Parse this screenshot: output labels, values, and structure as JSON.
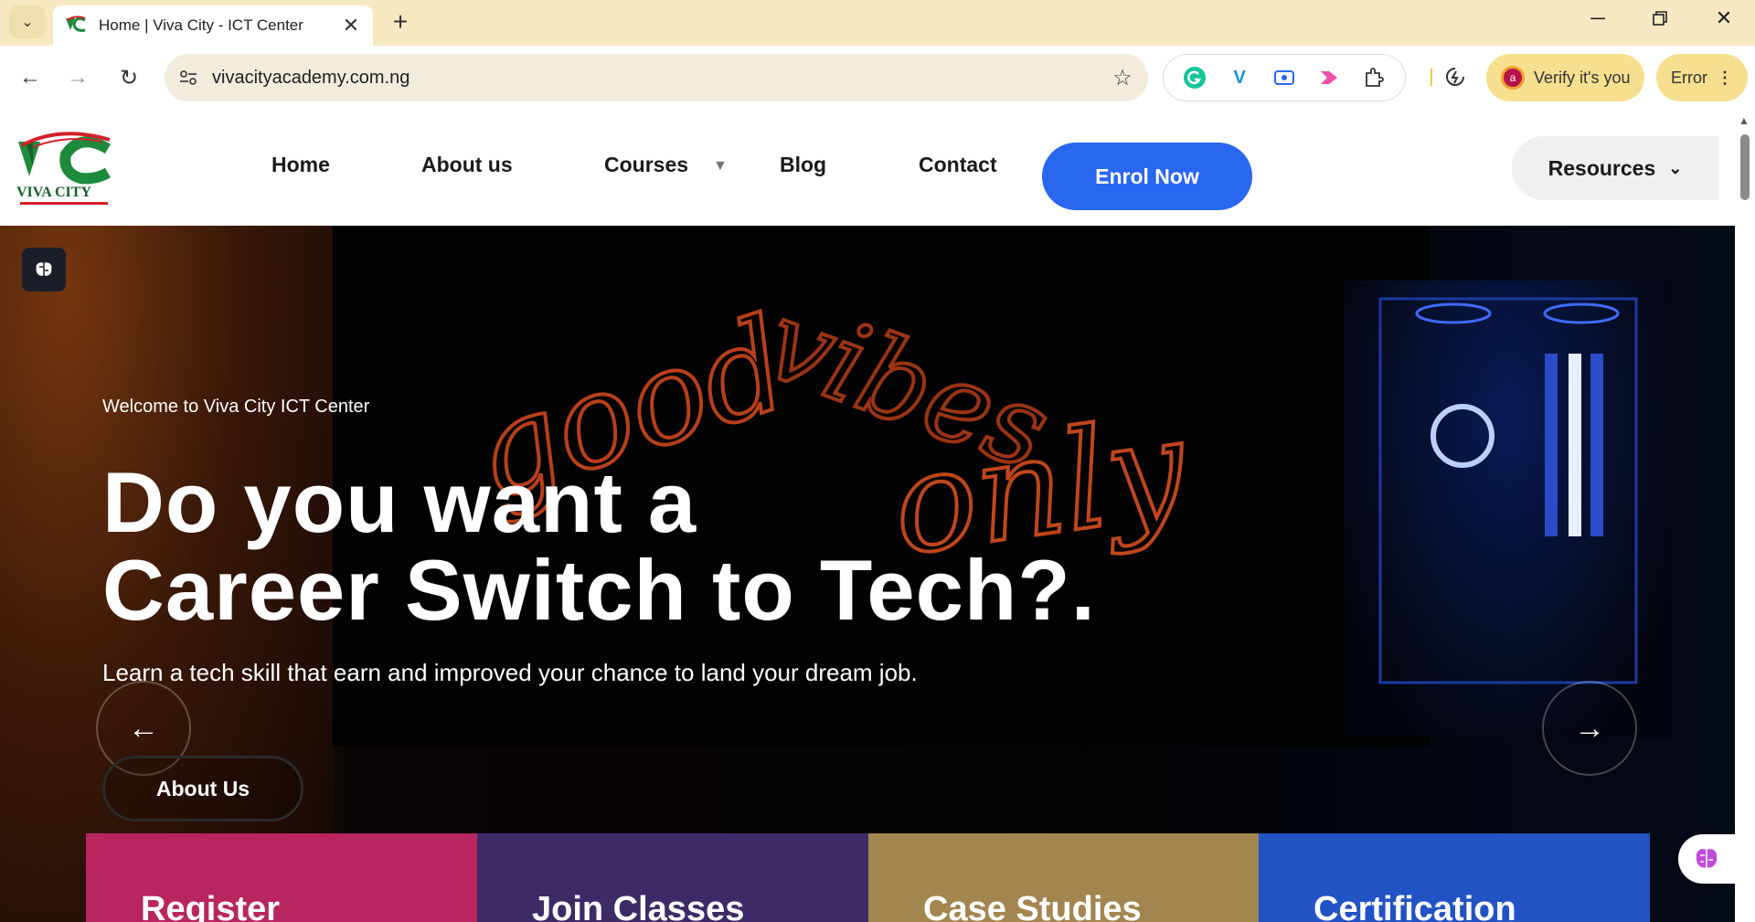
{
  "browser": {
    "tab_title": "Home | Viva City - ICT Center",
    "url": "vivacityacademy.com.ng",
    "verify_label": "Verify it's you",
    "profile_initial": "a",
    "error_label": "Error",
    "icons": [
      "tab-search-icon",
      "new-tab-icon",
      "minimize-icon",
      "restore-icon",
      "close-icon",
      "back-icon",
      "forward-icon",
      "reload-icon",
      "site-info-icon",
      "bookmark-star-icon",
      "grammarly-icon",
      "vimeo-icon",
      "screen-record-icon",
      "video-extension-icon",
      "extensions-icon",
      "performance-icon",
      "more-menu-icon"
    ]
  },
  "header": {
    "logo_text": "VIVA CITY",
    "nav": {
      "home": "Home",
      "about": "About us",
      "courses": "Courses",
      "blog": "Blog",
      "contact": "Contact"
    },
    "enrol_label": "Enrol Now",
    "resources_label": "Resources"
  },
  "hero": {
    "subtitle": "Welcome to Viva City ICT Center",
    "title_line1": "Do you want a",
    "title_line2": "Career Switch to Tech?.",
    "description": "Learn a tech skill that earn and improved your chance to land your dream job.",
    "button_label": "About Us",
    "neon_text": [
      "good",
      "vibes",
      "only"
    ]
  },
  "features": [
    {
      "label": "Register",
      "color": "#b8255f"
    },
    {
      "label": "Join Classes",
      "color": "#3f2a68"
    },
    {
      "label": "Case Studies",
      "color": "#a3864f"
    },
    {
      "label": "Certification",
      "color": "#2253c4"
    }
  ],
  "colors": {
    "accent": "#2a67f0",
    "tabbar": "#f6e9c1",
    "logo_green": "#1e8a3c",
    "logo_red": "#d4202a"
  }
}
